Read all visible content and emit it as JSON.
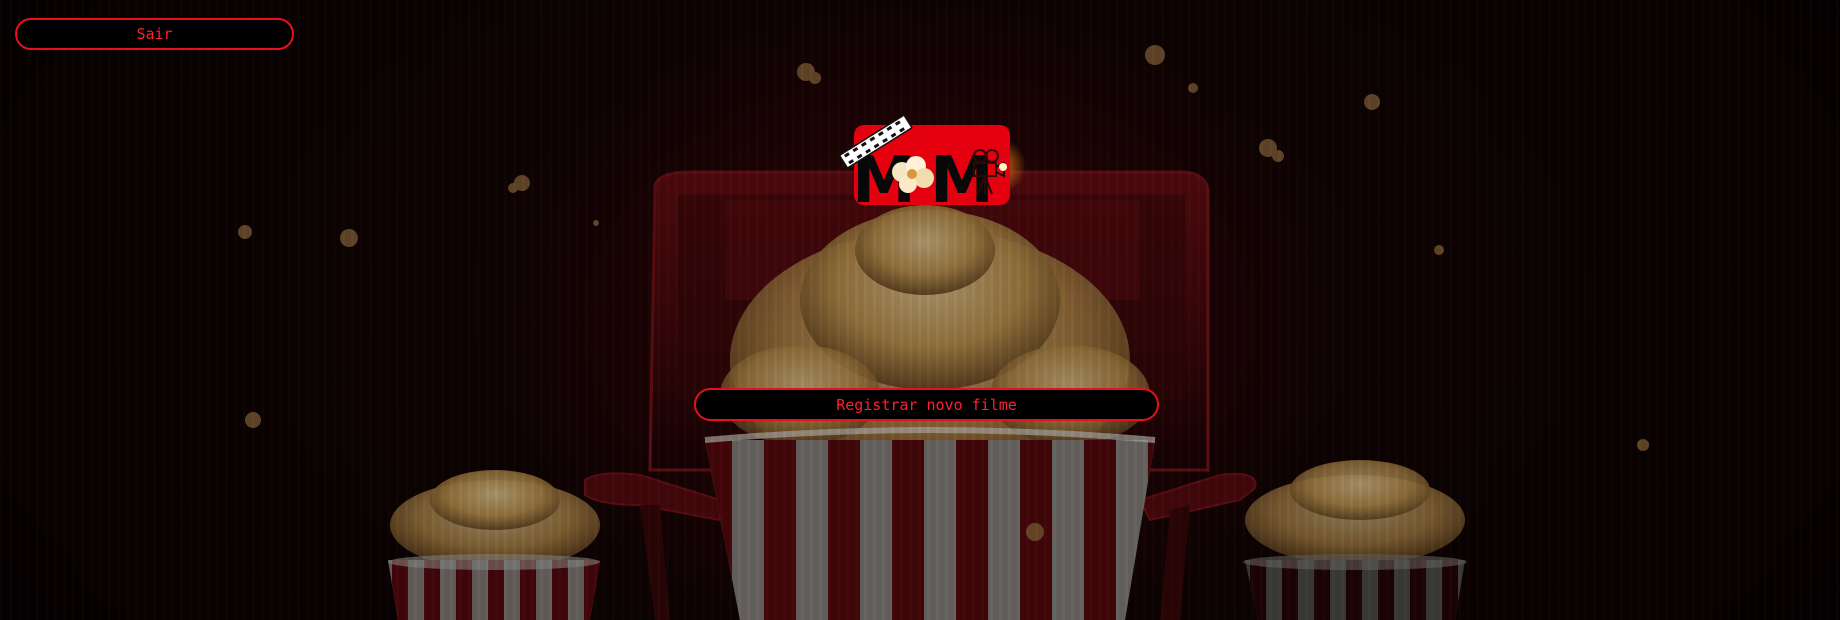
{
  "header": {
    "exit_label": "Sair"
  },
  "main": {
    "register_label": "Registrar novo filme"
  },
  "logo": {
    "letters": "MM",
    "icons": [
      "film-strip-icon",
      "popcorn-icon",
      "movie-camera-icon"
    ]
  },
  "background": {
    "description_icons": [
      "cinema-seat",
      "popcorn-bucket",
      "popcorn-kernel"
    ]
  },
  "colors": {
    "accent": "#e8101a",
    "button_text": "#ff2030",
    "button_bg": "#000000",
    "logo_bg": "#e4000e"
  }
}
